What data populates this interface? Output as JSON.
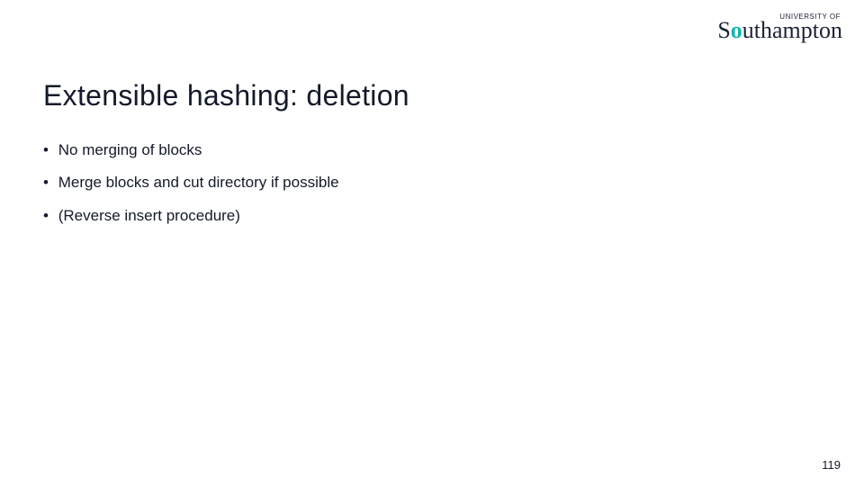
{
  "logo": {
    "tagline": "UNIVERSITY OF",
    "name_html_parts": {
      "pre": "S",
      "accent": "o",
      "post": "uthampton"
    }
  },
  "title": "Extensible hashing: deletion",
  "bullets": [
    "No merging of blocks",
    "Merge blocks and cut directory if possible",
    "(Reverse insert procedure)"
  ],
  "page_number": "119"
}
